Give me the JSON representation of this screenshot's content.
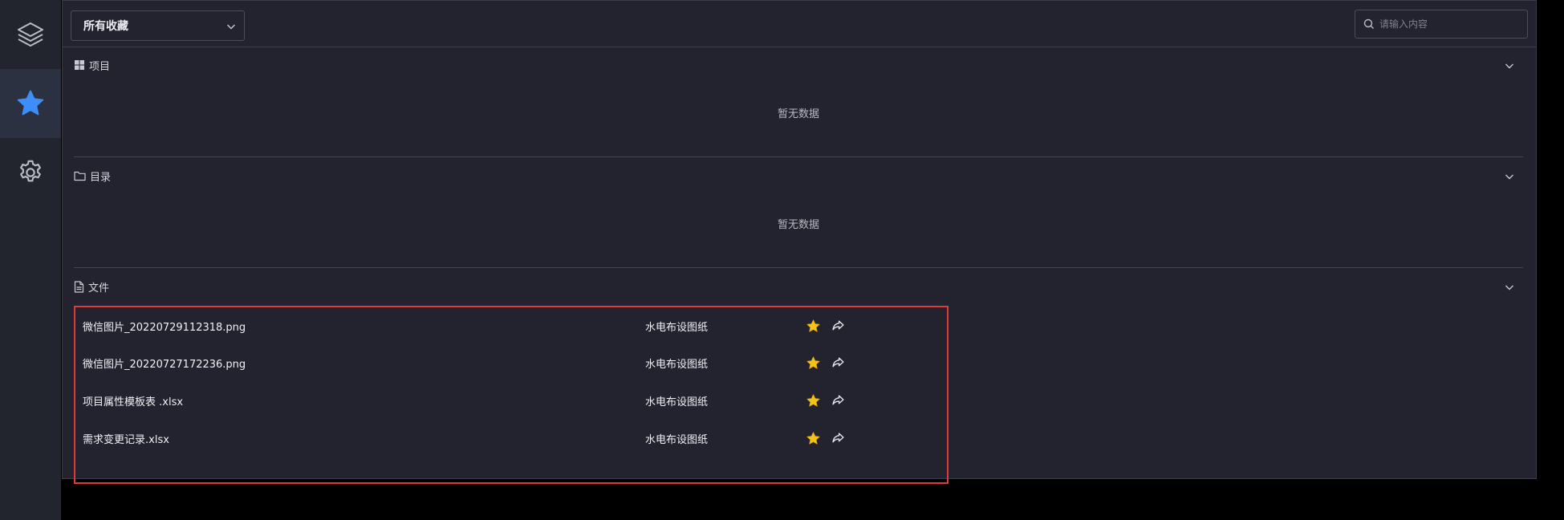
{
  "colors": {
    "rail_bg": "#23252e",
    "panel_bg": "#22232e",
    "accent": "#3d8ef7",
    "star": "#f3c21b",
    "highlight_border": "#e1383b"
  },
  "rail": {
    "items": [
      {
        "icon": "layers-icon",
        "active": false
      },
      {
        "icon": "star-icon",
        "active": true
      },
      {
        "icon": "gear-icon",
        "active": false
      }
    ]
  },
  "toolbar": {
    "filter_value": "所有收藏",
    "search_placeholder": "请输入内容"
  },
  "sections": {
    "projects": {
      "title": "项目",
      "empty_text": "暂无数据"
    },
    "directories": {
      "title": "目录",
      "empty_text": "暂无数据"
    },
    "files": {
      "title": "文件",
      "rows": [
        {
          "name": "微信图片_20220729112318.png",
          "folder": "水电布设图纸"
        },
        {
          "name": "微信图片_20220727172236.png",
          "folder": "水电布设图纸"
        },
        {
          "name": "项目属性模板表 .xlsx",
          "folder": "水电布设图纸"
        },
        {
          "name": "需求变更记录.xlsx",
          "folder": "水电布设图纸"
        }
      ]
    }
  }
}
